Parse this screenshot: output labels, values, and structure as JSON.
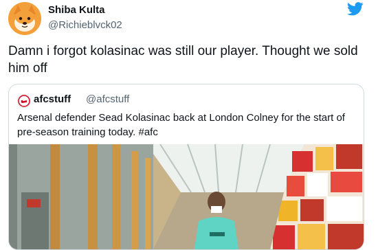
{
  "tweet": {
    "author_name": "Shiba Kulta",
    "author_handle": "@Richieblvck02",
    "text": "Damn i forgot kolasinac was still our player.  Thought we sold him off"
  },
  "quoted_tweet": {
    "author_name": "afcstuff",
    "author_handle": "@afcstuff",
    "text": "Arsenal defender Sead Kolasinac back at London Colney for the start of pre-season training today. #afc"
  },
  "icons": {
    "twitter": "twitter-bird-icon",
    "avatar": "shiba-dog-avatar",
    "quote_avatar": "afc-crest-avatar"
  },
  "colors": {
    "brand": "#1d9bf0",
    "text": "#0f1419",
    "secondary": "#536471",
    "border": "#cfd9de"
  }
}
